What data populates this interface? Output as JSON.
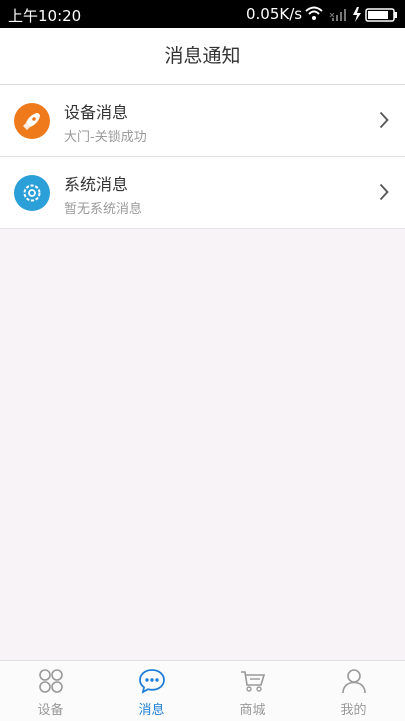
{
  "status_bar": {
    "time": "上午10:20",
    "network_speed": "0.05K/s",
    "icons": [
      "wifi-icon",
      "signal-icon",
      "charging-icon",
      "battery-icon"
    ]
  },
  "header": {
    "title": "消息通知"
  },
  "messages": [
    {
      "title": "设备消息",
      "subtitle": "大门-关锁成功",
      "icon": "rocket-icon",
      "icon_color": "#ee7a1c"
    },
    {
      "title": "系统消息",
      "subtitle": "暂无系统消息",
      "icon": "gear-icon",
      "icon_color": "#2a9fd8"
    }
  ],
  "tabbar": {
    "tabs": [
      {
        "label": "设备",
        "icon": "grid-icon",
        "active": false
      },
      {
        "label": "消息",
        "icon": "chat-icon",
        "active": true
      },
      {
        "label": "商城",
        "icon": "cart-icon",
        "active": false
      },
      {
        "label": "我的",
        "icon": "person-icon",
        "active": false
      }
    ]
  },
  "colors": {
    "accent": "#1e7fd6",
    "inactive": "#999999",
    "page_background": "#f7f3f6"
  }
}
